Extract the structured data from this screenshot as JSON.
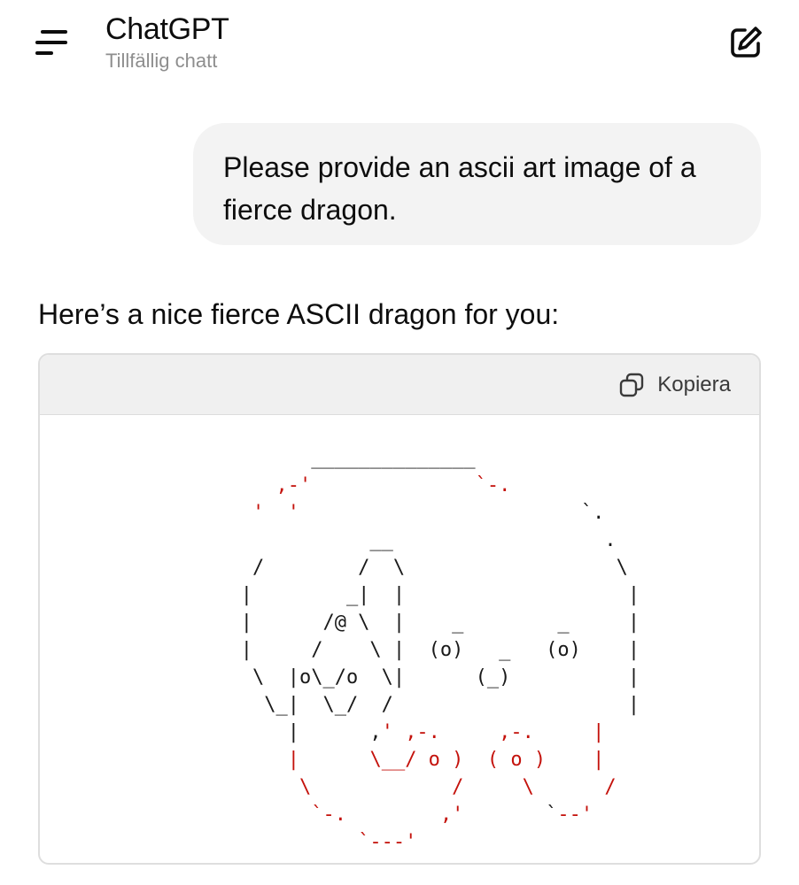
{
  "header": {
    "title": "ChatGPT",
    "subtitle": "Tillfällig chatt",
    "menu_icon": "menu-icon",
    "new_chat_icon": "edit-icon"
  },
  "messages": {
    "user_text": "Please provide an ascii art image of a fierce dragon.",
    "assistant_text": "Here’s a nice fierce ASCII dragon for you:"
  },
  "code_block": {
    "copy_label": "Kopiera",
    "copy_icon": "copy-icon",
    "ascii_lines": [
      [
        {
          "t": "         ______________",
          "c": "k"
        }
      ],
      [
        {
          "t": "      ",
          "c": "k"
        },
        {
          "t": ",-'",
          "c": "r"
        },
        {
          "t": "              ",
          "c": "k"
        },
        {
          "t": "`-.",
          "c": "r"
        }
      ],
      [
        {
          "t": "    ",
          "c": "k"
        },
        {
          "t": "'",
          "c": "r"
        },
        {
          "t": "  ",
          "c": "k"
        },
        {
          "t": "'",
          "c": "r"
        },
        {
          "t": "                        `.",
          "c": "k"
        }
      ],
      [
        {
          "t": "              __                  .",
          "c": "k"
        }
      ],
      [
        {
          "t": "    /        /  \\                  \\",
          "c": "k"
        }
      ],
      [
        {
          "t": "   |        _|  |                   |",
          "c": "k"
        }
      ],
      [
        {
          "t": "   |      /@ \\  |    _        _     |",
          "c": "k"
        }
      ],
      [
        {
          "t": "   |     /    \\ |  (o)   _   (o)    |",
          "c": "k"
        }
      ],
      [
        {
          "t": "    \\  |o\\_/o  \\|      (_)          |",
          "c": "k"
        }
      ],
      [
        {
          "t": "     \\_|  \\_/  /                    |",
          "c": "k"
        }
      ],
      [
        {
          "t": "       |      ,",
          "c": "k"
        },
        {
          "t": "'",
          "c": "r"
        },
        {
          "t": " ",
          "c": "k"
        },
        {
          "t": ",-.",
          "c": "r"
        },
        {
          "t": "     ",
          "c": "k"
        },
        {
          "t": ",-.",
          "c": "r"
        },
        {
          "t": "     ",
          "c": "k"
        },
        {
          "t": "|",
          "c": "r"
        }
      ],
      [
        {
          "t": "       ",
          "c": "k"
        },
        {
          "t": "|",
          "c": "r"
        },
        {
          "t": "      ",
          "c": "k"
        },
        {
          "t": "\\__/ o )",
          "c": "r"
        },
        {
          "t": "  ",
          "c": "k"
        },
        {
          "t": "( o )",
          "c": "r"
        },
        {
          "t": "    ",
          "c": "k"
        },
        {
          "t": "|",
          "c": "r"
        }
      ],
      [
        {
          "t": "        ",
          "c": "k"
        },
        {
          "t": "\\",
          "c": "r"
        },
        {
          "t": "            ",
          "c": "k"
        },
        {
          "t": "/",
          "c": "r"
        },
        {
          "t": "     ",
          "c": "k"
        },
        {
          "t": "\\",
          "c": "r"
        },
        {
          "t": "      ",
          "c": "k"
        },
        {
          "t": "/",
          "c": "r"
        }
      ],
      [
        {
          "t": "         ",
          "c": "k"
        },
        {
          "t": "`-.",
          "c": "r"
        },
        {
          "t": "        ",
          "c": "k"
        },
        {
          "t": ",'",
          "c": "r"
        },
        {
          "t": "       `",
          "c": "k"
        },
        {
          "t": "--'",
          "c": "r"
        }
      ],
      [
        {
          "t": "             ",
          "c": "k"
        },
        {
          "t": "`---'",
          "c": "r"
        }
      ]
    ]
  }
}
